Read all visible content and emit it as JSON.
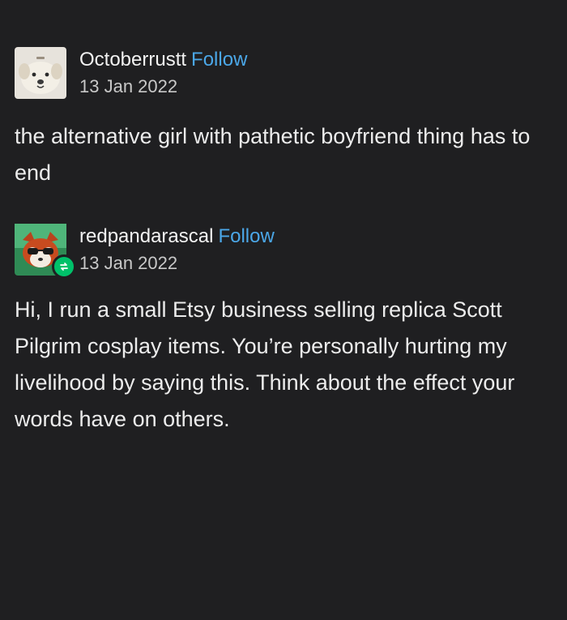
{
  "posts": [
    {
      "username": "Octoberrustt",
      "follow_label": "Follow",
      "date": "13 Jan 2022",
      "avatar_icon": "puppy-avatar",
      "text": "the alternative girl with pathetic boyfriend thing has to end"
    },
    {
      "username": "redpandarascal",
      "follow_label": "Follow",
      "date": "13 Jan 2022",
      "avatar_icon": "red-panda-avatar",
      "badge_icon": "reblog-icon",
      "text": "Hi, I run a small Etsy business selling replica Scott Pilgrim cosplay items. You’re personally hurting my livelihood by saying this. Think about the effect your words have on others."
    }
  ],
  "colors": {
    "background": "#1f1f21",
    "text": "#ececec",
    "follow": "#4ba7e8",
    "badge": "#00c16a"
  }
}
